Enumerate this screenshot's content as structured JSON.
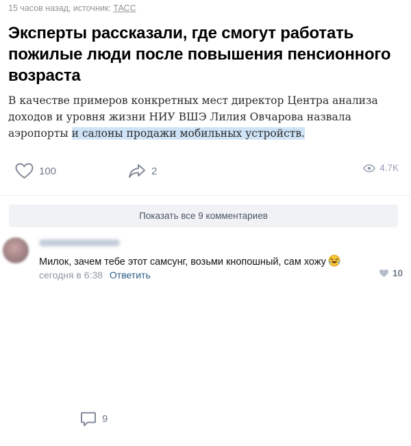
{
  "meta": {
    "time": "15 часов назад, источник:",
    "source": "ТАСС"
  },
  "article": {
    "title": "Эксперты рассказали, где смогут работать пожилые люди после повышения пенсионного возраста",
    "lead_plain": "В качестве примеров конкретных мест директор Центра анализа доходов и уровня жизни НИУ ВШЭ Лилия Овчарова назвала аэропорты ",
    "lead_highlighted": "и салоны продажи мобильных устройств."
  },
  "actions": {
    "likes": "100",
    "comments": "9",
    "shares": "2",
    "views": "4.7K"
  },
  "show_all_label": "Показать все 9 комментариев",
  "comment": {
    "author_hidden": true,
    "text": "Милок, зачем тебе этот самсунг, возьми кнопошный, сам хожу",
    "emoji": "rofl-emoji",
    "time": "сегодня в 6:38",
    "reply_label": "Ответить",
    "likes": "10"
  },
  "colors": {
    "link": "#2a5885",
    "highlight": "#cfe3f7",
    "icon": "#828a99",
    "button_bg": "#f0f2f5"
  }
}
